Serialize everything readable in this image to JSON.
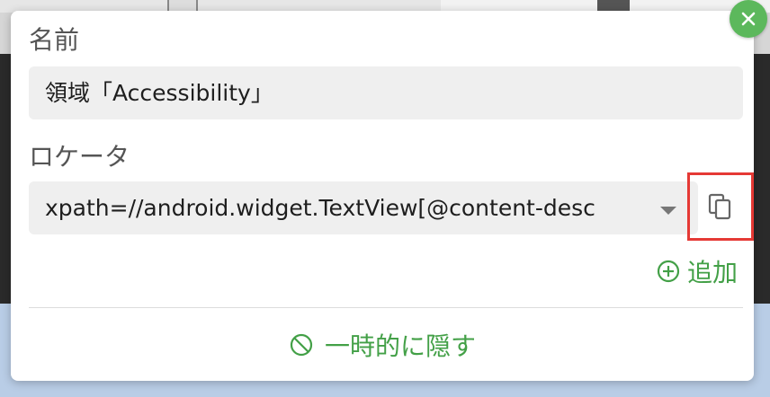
{
  "dialog": {
    "name_label": "名前",
    "name_value": "領域「Accessibility」",
    "locator_label": "ロケータ",
    "locator_value": "xpath=//android.widget.TextView[@content-desc",
    "add_label": "追加",
    "hide_label": "一時的に隠す"
  },
  "icons": {
    "close": "close-icon",
    "copy": "copy-icon",
    "add": "plus-circle-icon",
    "hide": "eye-off-icon",
    "dropdown": "caret-down-icon"
  },
  "colors": {
    "accent_green": "#43a047",
    "close_green": "#5cb85c",
    "highlight_red": "#e53935"
  }
}
